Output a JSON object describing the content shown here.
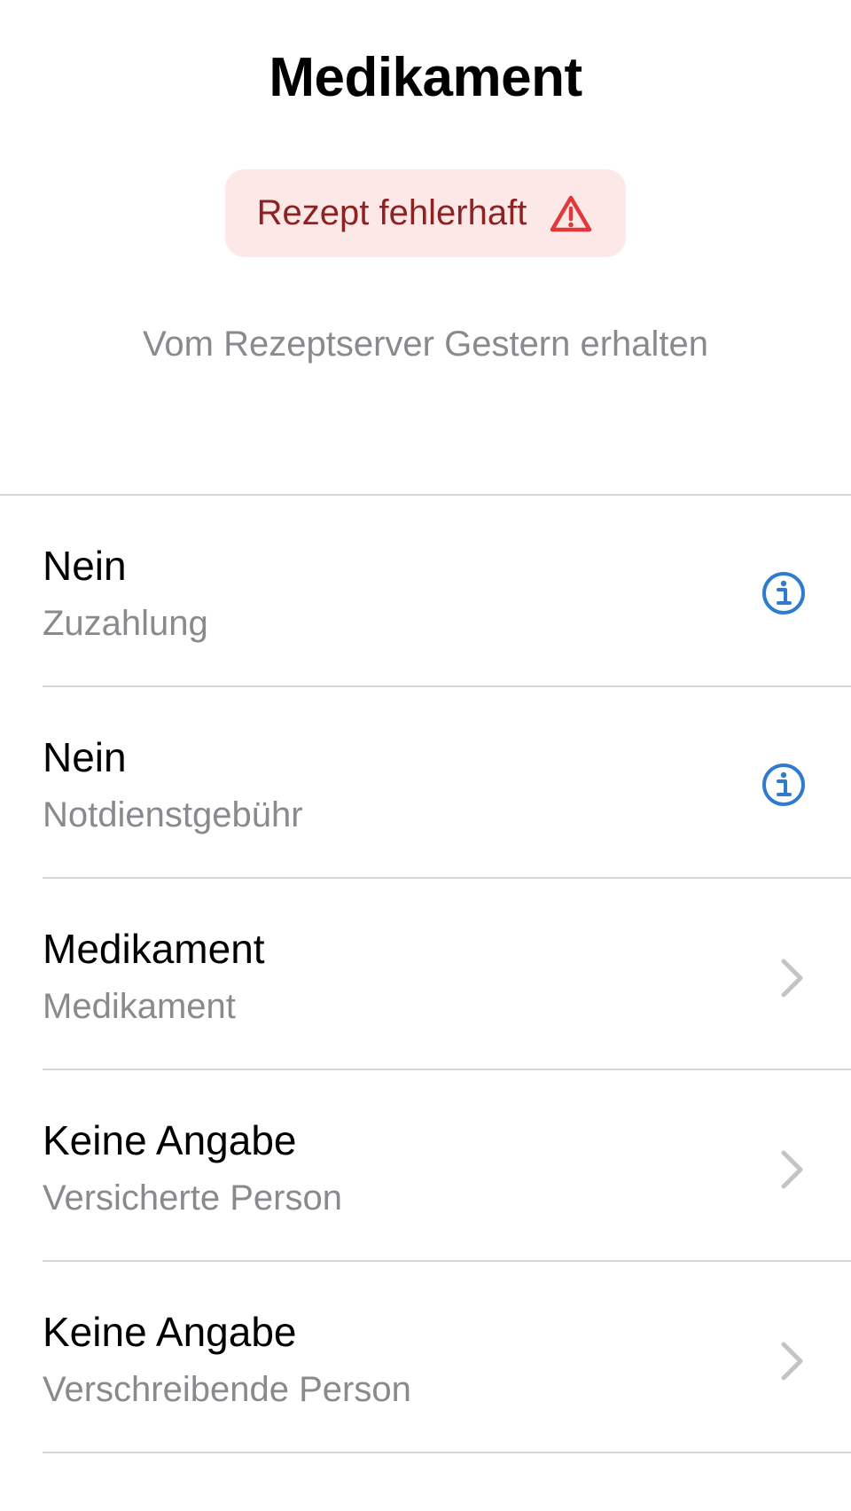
{
  "header": {
    "title": "Medikament"
  },
  "status": {
    "label": "Rezept fehlerhaft",
    "icon": "warning-triangle-icon",
    "background": "#fde8e8",
    "text_color": "#8b2323",
    "icon_color": "#e0393b"
  },
  "subtitle": "Vom Rezeptserver Gestern erhalten",
  "rows": [
    {
      "value": "Nein",
      "label": "Zuzahlung",
      "icon": "info-icon"
    },
    {
      "value": "Nein",
      "label": "Notdienstgebühr",
      "icon": "info-icon"
    },
    {
      "value": "Medikament",
      "label": "Medikament",
      "icon": "chevron-right-icon"
    },
    {
      "value": "Keine Angabe",
      "label": "Versicherte Person",
      "icon": "chevron-right-icon"
    },
    {
      "value": "Keine Angabe",
      "label": "Verschreibende Person",
      "icon": "chevron-right-icon"
    }
  ],
  "colors": {
    "accent": "#2e7bd0",
    "secondary_text": "#8a8a8e",
    "chevron": "#c4c4c7",
    "separator": "#d6d6d9"
  }
}
